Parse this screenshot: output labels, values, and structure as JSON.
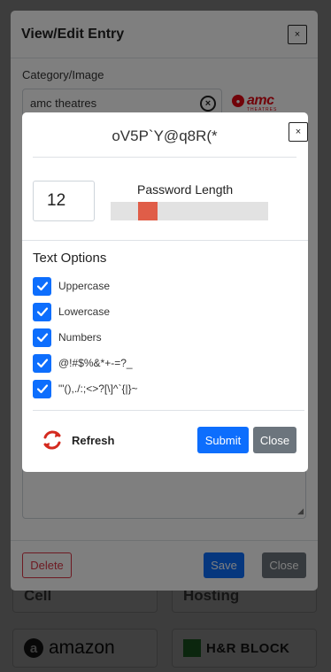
{
  "background": {
    "tiles": [
      "Cell",
      "Hosting",
      "amazon",
      "H&R BLOCK"
    ]
  },
  "entry_modal": {
    "title": "View/Edit Entry",
    "close_label": "×",
    "category_label": "Category/Image",
    "category_value": "amc theatres",
    "category_clear_label": "×",
    "logo_text": "amc",
    "logo_subtext": "THEATRES",
    "delete_label": "Delete",
    "save_label": "Save",
    "close_button_label": "Close"
  },
  "password_modal": {
    "generated_password": "oV5P`Y@q8R(*",
    "close_label": "×",
    "length_value": "12",
    "length_label": "Password Length",
    "length_level_fraction": 0.2,
    "text_options_title": "Text Options",
    "options": [
      {
        "label": "Uppercase",
        "checked": true
      },
      {
        "label": "Lowercase",
        "checked": true
      },
      {
        "label": "Numbers",
        "checked": true
      },
      {
        "label": "@!#$%&*+-=?_",
        "checked": true
      },
      {
        "label": "\"'(),./:;<>?[\\]^`{|}~",
        "checked": true
      }
    ],
    "refresh_label": "Refresh",
    "submit_label": "Submit",
    "close_button_label": "Close"
  },
  "colors": {
    "primary": "#0d6efd",
    "secondary": "#6c757d",
    "danger": "#dc3545",
    "slider_thumb": "#e05d48",
    "refresh_icon": "#d42a1f"
  }
}
